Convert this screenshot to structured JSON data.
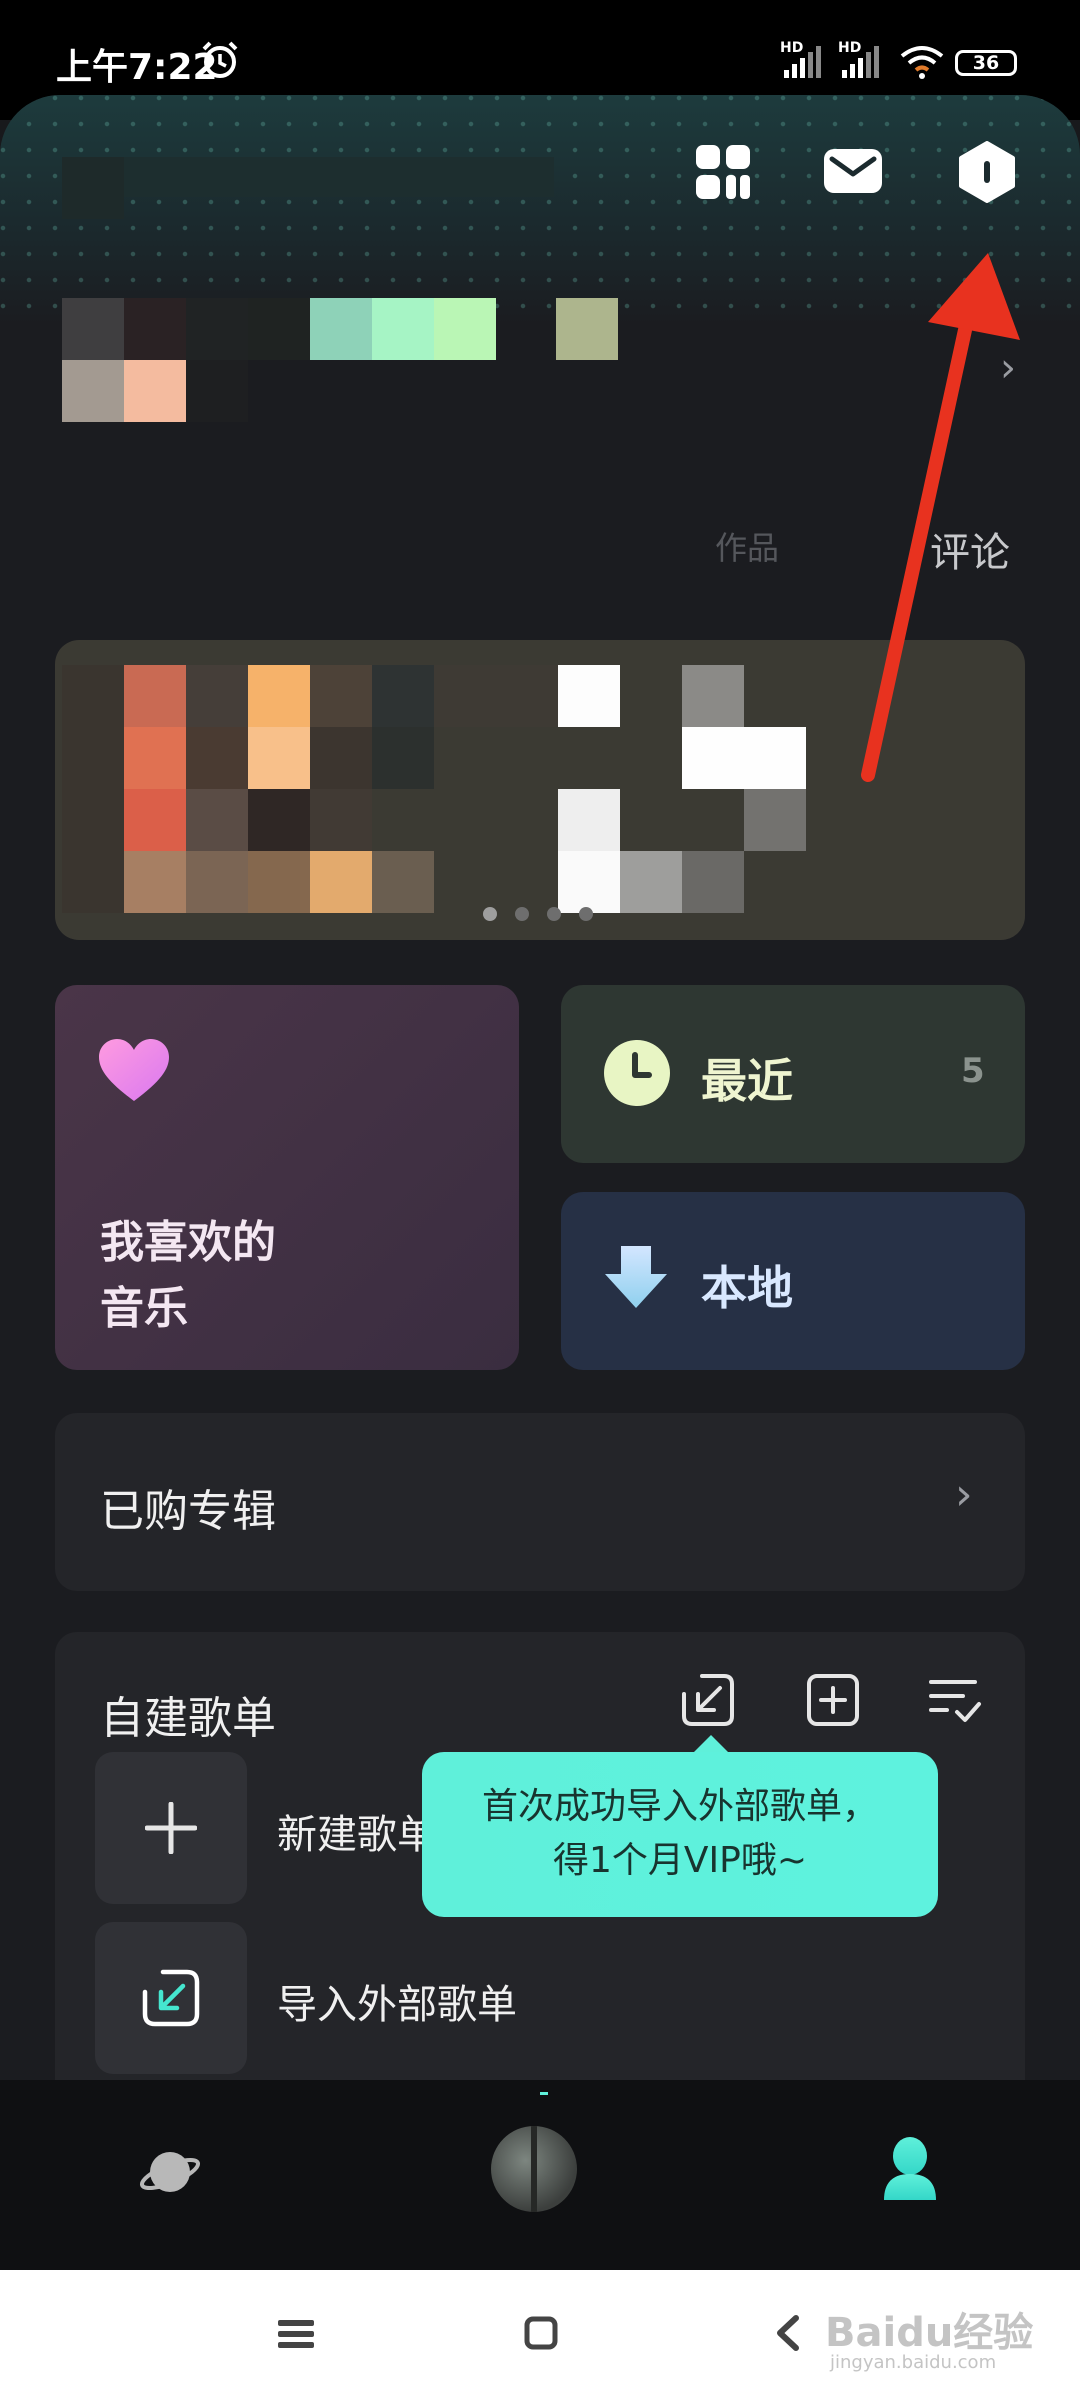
{
  "status_bar": {
    "time": "上午7:22",
    "signal1": "HD",
    "signal2": "HD",
    "battery": "36"
  },
  "header": {
    "apps_icon": "grid-icon",
    "mail_icon": "mail-icon",
    "settings_icon": "hexagon-icon"
  },
  "profile": {
    "faded_label": "作品",
    "comment_label": "评论"
  },
  "cards": {
    "favorite_label": "我喜欢的\n音乐",
    "recent_label": "最近",
    "recent_count": "5",
    "local_label": "本地"
  },
  "purchased": {
    "label": "已购专辑"
  },
  "playlists": {
    "title": "自建歌单",
    "items": [
      {
        "label": "新建歌单"
      },
      {
        "label": "导入外部歌单"
      }
    ],
    "tooltip_line1": "首次成功导入外部歌单，",
    "tooltip_line2": "得1个月VIP哦~"
  },
  "watermark": {
    "text": "Baidu经验",
    "sub": "jingyan.baidu.com"
  },
  "colors": {
    "accent": "#5ff0da",
    "arrow": "#e8321f"
  }
}
